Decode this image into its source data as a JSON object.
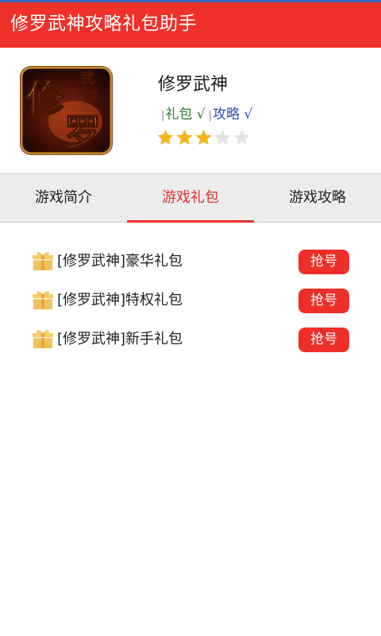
{
  "appbar": {
    "title": "修罗武神攻略礼包助手"
  },
  "game": {
    "name": "修罗武神",
    "icon_name": "game-logo-icon",
    "tag_gift": "礼包 √",
    "tag_guide": "攻略 √",
    "tag_separator": "|",
    "rating": 3,
    "rating_max": 5
  },
  "tabs": [
    {
      "label": "游戏简介"
    },
    {
      "label": "游戏礼包"
    },
    {
      "label": "游戏攻略"
    }
  ],
  "active_tab": "游戏礼包",
  "gifts": [
    {
      "name": "[修罗武神]豪华礼包",
      "button": "抢号"
    },
    {
      "name": "[修罗武神]特权礼包",
      "button": "抢号"
    },
    {
      "name": "[修罗武神]新手礼包",
      "button": "抢号"
    }
  ],
  "colors": {
    "primary": "#f0302a",
    "star_on": "#f3b51b",
    "star_off": "#e3e3e3",
    "gift_icon": "#f2c15a"
  }
}
